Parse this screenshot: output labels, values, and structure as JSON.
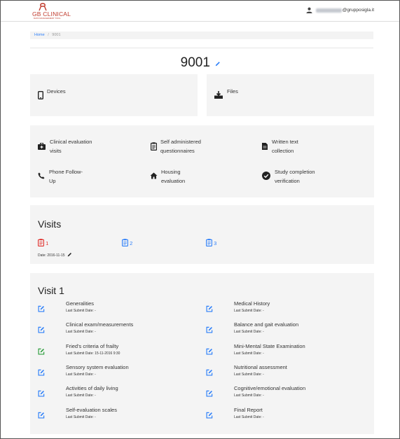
{
  "header": {
    "logo_text": "GB CLINICAL",
    "logo_subtext": "DATA MANAGEMENT TOOL",
    "user_email": "@grupposigla.it"
  },
  "breadcrumb": {
    "home": "Home",
    "separator": "/",
    "current": "9001"
  },
  "patient": {
    "id": "9001"
  },
  "top_cards": {
    "devices": "Devices",
    "files": "Files"
  },
  "menu": [
    {
      "line1": "Clinical evaluation",
      "line2": "visits",
      "icon": "medkit-icon"
    },
    {
      "line1": "Self administered",
      "line2": "questionnaires",
      "icon": "clipboard-icon"
    },
    {
      "line1": "Written text",
      "line2": "collection",
      "icon": "document-icon"
    },
    {
      "line1": "Phone Follow-",
      "line2": "Up",
      "icon": "phone-icon"
    },
    {
      "line1": "Housing",
      "line2": "evaluation",
      "icon": "home-icon"
    },
    {
      "line1": "Study completion",
      "line2": "verification",
      "icon": "check-circle-icon"
    }
  ],
  "visits": {
    "title": "Visits",
    "items": [
      {
        "number": "1",
        "color": "#e0302c"
      },
      {
        "number": "2",
        "color": "#2d7ff9"
      },
      {
        "number": "3",
        "color": "#2d7ff9"
      }
    ],
    "date_label": "Date: 2016-11-15"
  },
  "visit1": {
    "title": "Visit 1",
    "forms": [
      {
        "name": "Generalities",
        "submit": "Last Submit Date: -",
        "color": "#2d7ff9"
      },
      {
        "name": "Medical History",
        "submit": "Last Submit Date: -",
        "color": "#2d7ff9"
      },
      {
        "name": "Clinical exam/measurements",
        "submit": "Last Submit Date: -",
        "color": "#2d7ff9"
      },
      {
        "name": "Balance and gait evaluation",
        "submit": "Last Submit Date: -",
        "color": "#2d7ff9"
      },
      {
        "name": "Fried's criteria of frailty",
        "submit": "Last Submit Date: 15-11-2016 9:30",
        "color": "#2e9e3e"
      },
      {
        "name": "Mini-Mental State Examination",
        "submit": "Last Submit Date: -",
        "color": "#2d7ff9"
      },
      {
        "name": "Sensory system evaluation",
        "submit": "Last Submit Date: -",
        "color": "#2d7ff9"
      },
      {
        "name": "Nutritional assessment",
        "submit": "Last Submit Date: -",
        "color": "#2d7ff9"
      },
      {
        "name": "Activities of daily living",
        "submit": "Last Submit Date: -",
        "color": "#2d7ff9"
      },
      {
        "name": "Cognitive/emotional evaluation",
        "submit": "Last Submit Date: -",
        "color": "#2d7ff9"
      },
      {
        "name": "Self-evaluation scales",
        "submit": "Last Submit Date: -",
        "color": "#2d7ff9"
      },
      {
        "name": "Final Report",
        "submit": "Last Submit Date: -",
        "color": "#2d7ff9"
      }
    ]
  }
}
